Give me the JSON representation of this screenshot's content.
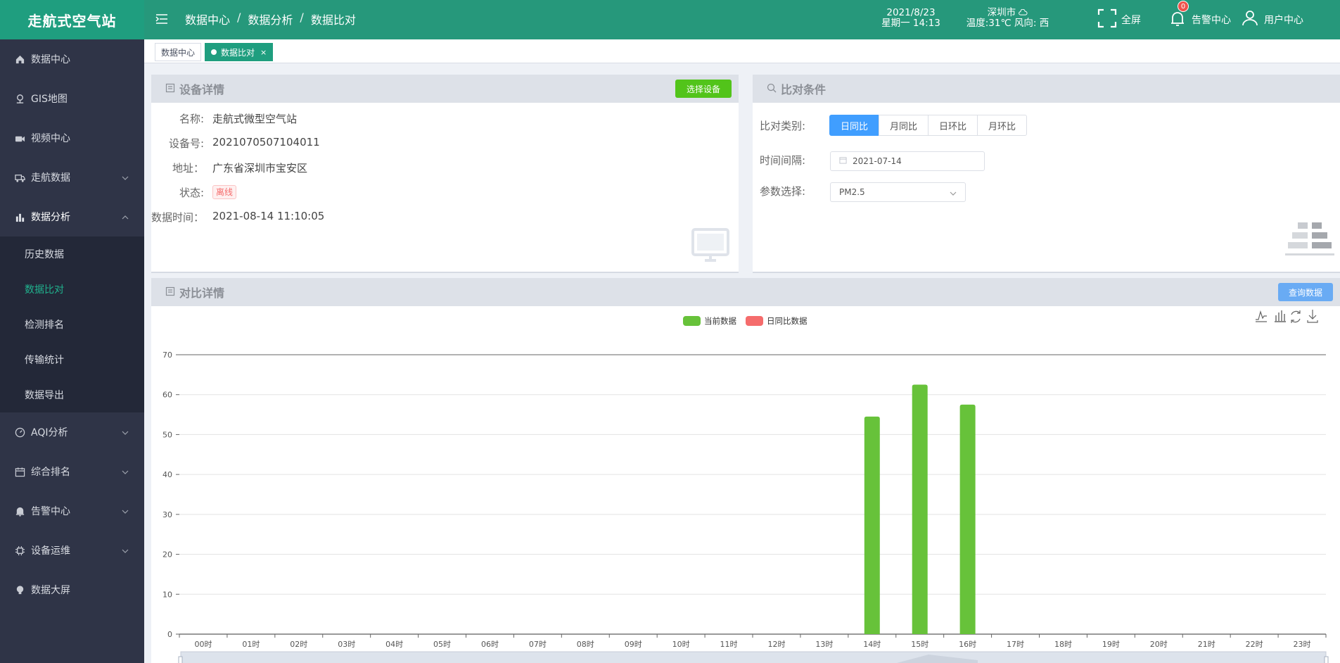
{
  "app": {
    "title": "走航式空气站"
  },
  "sidebar": {
    "items": [
      {
        "label": "数据中心",
        "icon": "home-icon"
      },
      {
        "label": "GIS地图",
        "icon": "map-pin-icon"
      },
      {
        "label": "视频中心",
        "icon": "camera-icon"
      },
      {
        "label": "走航数据",
        "icon": "truck-icon"
      },
      {
        "label": "数据分析",
        "icon": "bar-chart-icon"
      },
      {
        "label": "AQI分析",
        "icon": "gauge-icon"
      },
      {
        "label": "综合排名",
        "icon": "calendar-icon"
      },
      {
        "label": "告警中心",
        "icon": "bell-icon"
      },
      {
        "label": "设备运维",
        "icon": "chip-icon"
      },
      {
        "label": "数据大屏",
        "icon": "bulb-icon"
      }
    ],
    "submenu": [
      "历史数据",
      "数据比对",
      "检测排名",
      "传输统计",
      "数据导出"
    ],
    "active_sub": "数据比对"
  },
  "header": {
    "breadcrumb": [
      "数据中心",
      "数据分析",
      "数据比对"
    ],
    "date": "2021/8/23",
    "weekday_time": "星期一 14:13",
    "city": "深圳市",
    "weather": "温度:31℃ 风向: 西",
    "fullscreen": "全屏",
    "alarm": "告警中心",
    "alarm_count": "0",
    "user": "用户中心"
  },
  "tags": {
    "home": "数据中心",
    "current": "数据比对",
    "close": "×"
  },
  "device": {
    "title": "设备详情",
    "select_btn": "选择设备",
    "name_label": "名称:",
    "name": "走航式微型空气站",
    "id_label": "设备号:",
    "id": "2021070507104011",
    "addr_label": "地址：",
    "addr": "广东省深圳市宝安区",
    "status_label": "状态:",
    "status": "离线",
    "time_label": "数据时间：",
    "time": "2021-08-14 11:10:05"
  },
  "compare": {
    "title": "比对条件",
    "type_label": "比对类别:",
    "types": [
      "日同比",
      "月同比",
      "日环比",
      "月环比"
    ],
    "interval_label": "时间间隔:",
    "date": "2021-07-14",
    "param_label": "参数选择:",
    "param": "PM2.5"
  },
  "detail": {
    "title": "对比详情",
    "query_btn": "查询数据"
  },
  "chart_data": {
    "type": "bar",
    "categories": [
      "00时",
      "01时",
      "02时",
      "03时",
      "04时",
      "05时",
      "06时",
      "07时",
      "08时",
      "09时",
      "10时",
      "11时",
      "12时",
      "13时",
      "14时",
      "15时",
      "16时",
      "17时",
      "18时",
      "19时",
      "20时",
      "21时",
      "22时",
      "23时"
    ],
    "series": [
      {
        "name": "当前数据",
        "color": "#67c23a",
        "values": [
          null,
          null,
          null,
          null,
          null,
          null,
          null,
          null,
          null,
          null,
          null,
          null,
          null,
          null,
          54.5,
          62.5,
          57.5,
          null,
          null,
          null,
          null,
          null,
          null,
          null
        ]
      },
      {
        "name": "日同比数据",
        "color": "#f56c6c",
        "values": [
          null,
          null,
          null,
          null,
          null,
          null,
          null,
          null,
          null,
          null,
          null,
          null,
          null,
          null,
          null,
          null,
          null,
          null,
          null,
          null,
          null,
          null,
          null,
          null
        ]
      }
    ],
    "yticks": [
      0,
      10,
      20,
      30,
      40,
      50,
      60,
      70
    ],
    "ylim": [
      0,
      70
    ]
  }
}
